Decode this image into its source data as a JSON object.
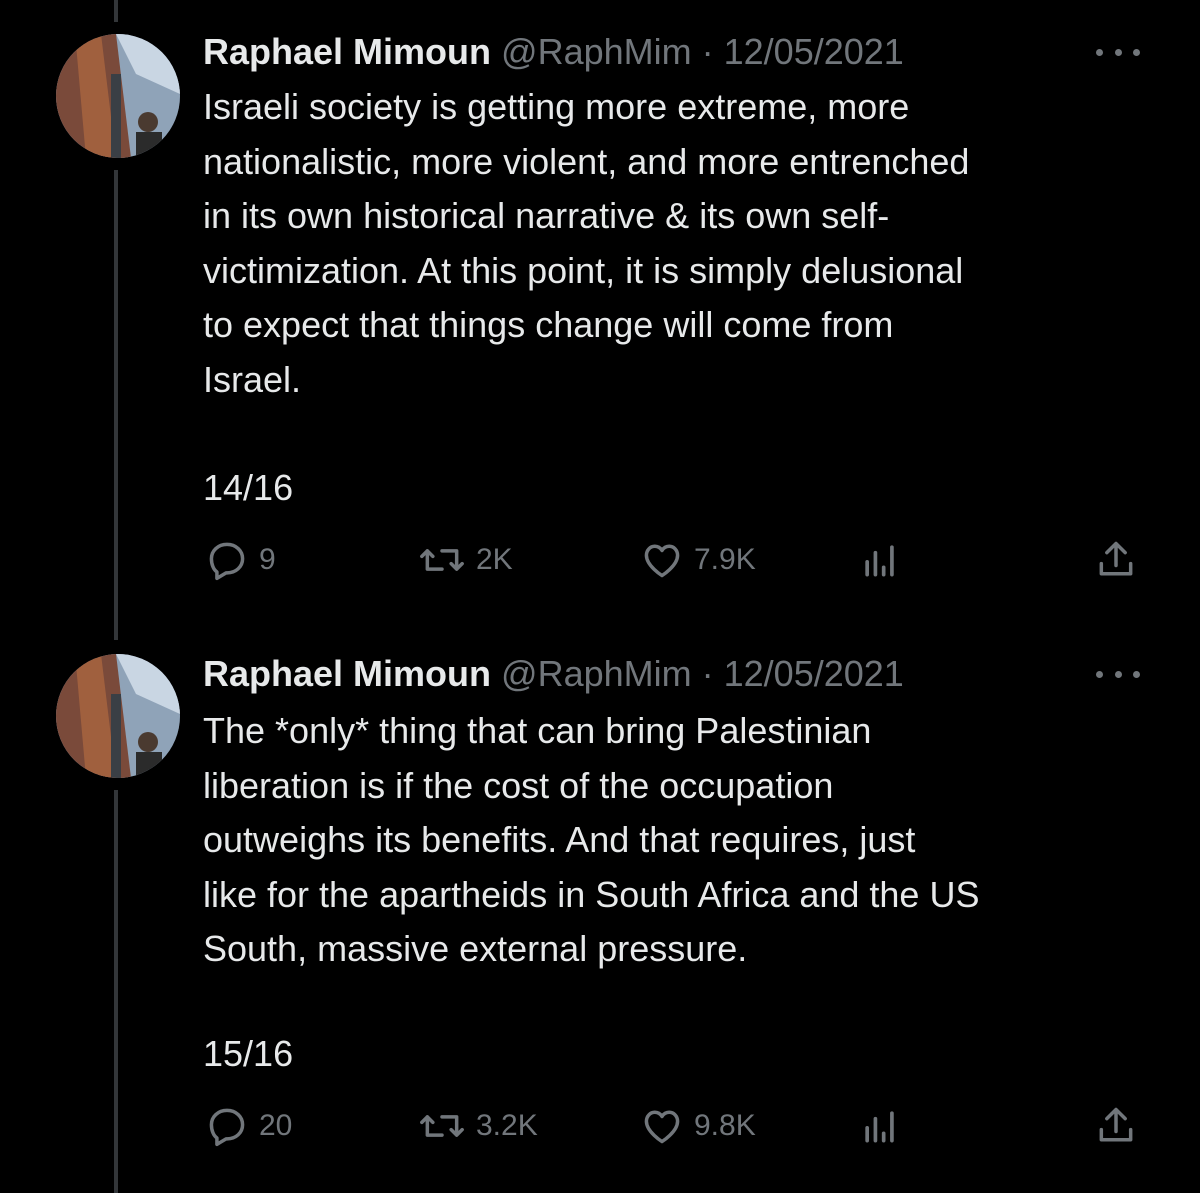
{
  "tweets": [
    {
      "name": "Raphael Mimoun",
      "handle": "@RaphMim",
      "separator": " · ",
      "date": "12/05/2021",
      "text": "Israeli society is getting more extreme, more\nnationalistic, more violent, and more entrenched\nin its own historical narrative & its own self-\nvictimization. At this point, it is simply delusional\nto expect that things change will come from\nIsrael.",
      "counter": "14/16",
      "replies": "9",
      "reposts": "2K",
      "likes": "7.9K"
    },
    {
      "name": "Raphael Mimoun",
      "handle": "@RaphMim",
      "separator": " · ",
      "date": "12/05/2021",
      "text": "The *only* thing that can bring Palestinian\nliberation is if the cost of the occupation\noutweighs its benefits. And that requires, just\nlike for the apartheids in South Africa and the US\nSouth, massive external pressure.",
      "counter": "15/16",
      "replies": "20",
      "reposts": "3.2K",
      "likes": "9.8K"
    }
  ],
  "icons": [
    "reply-icon",
    "repost-icon",
    "like-icon",
    "views-icon",
    "share-icon",
    "more-icon"
  ],
  "colors": {
    "background": "#000000",
    "text": "#e7e9ea",
    "muted": "#71767b",
    "thread_line": "#333639"
  }
}
